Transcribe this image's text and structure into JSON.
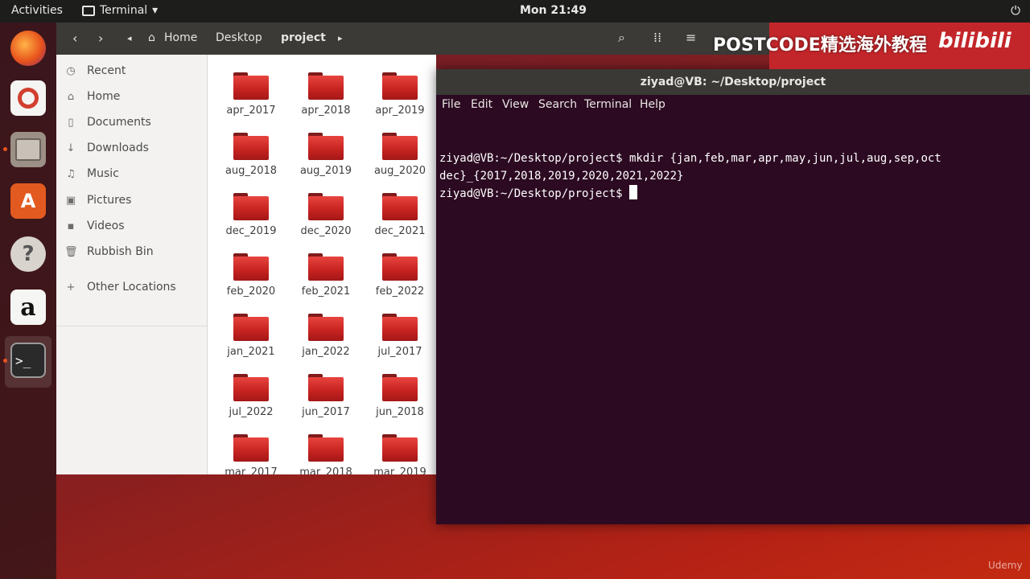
{
  "topbar": {
    "activities": "Activities",
    "app_name": "Terminal",
    "clock": "Mon 21:49",
    "power_icon": "power-icon"
  },
  "dock": {
    "items": [
      {
        "name": "firefox",
        "icon": "firefox-icon"
      },
      {
        "name": "rhythmbox",
        "icon": "rhythmbox-icon"
      },
      {
        "name": "files",
        "icon": "files-icon"
      },
      {
        "name": "ubuntu-software",
        "icon": "software-icon",
        "glyph": "A"
      },
      {
        "name": "help",
        "icon": "help-icon",
        "glyph": "?"
      },
      {
        "name": "amazon",
        "icon": "amazon-icon",
        "glyph": "a"
      },
      {
        "name": "terminal",
        "icon": "terminal-icon",
        "glyph": ">_"
      }
    ]
  },
  "file_manager": {
    "breadcrumb": [
      "Home",
      "Desktop",
      "project"
    ],
    "sidebar": [
      {
        "label": "Recent",
        "glyph": "◷"
      },
      {
        "label": "Home",
        "glyph": "⌂"
      },
      {
        "label": "Documents",
        "glyph": "▯"
      },
      {
        "label": "Downloads",
        "glyph": "↓"
      },
      {
        "label": "Music",
        "glyph": "♫"
      },
      {
        "label": "Pictures",
        "glyph": "▣"
      },
      {
        "label": "Videos",
        "glyph": "▪"
      },
      {
        "label": "Rubbish Bin",
        "glyph": "🗑"
      },
      {
        "label": "Other Locations",
        "glyph": "+"
      }
    ],
    "folders": [
      "apr_2017",
      "apr_2018",
      "apr_2019",
      "aug_2018",
      "aug_2019",
      "aug_2020",
      "dec_2019",
      "dec_2020",
      "dec_2021",
      "feb_2020",
      "feb_2021",
      "feb_2022",
      "jan_2021",
      "jan_2022",
      "jul_2017",
      "jul_2022",
      "jun_2017",
      "jun_2018",
      "mar_2017",
      "mar_2018",
      "mar_2019"
    ]
  },
  "terminal": {
    "title": "ziyad@VB: ~/Desktop/project",
    "menu": [
      "File",
      "Edit",
      "View",
      "Search",
      "Terminal",
      "Help"
    ],
    "lines": [
      "ziyad@VB:~/Desktop/project$ mkdir {jan,feb,mar,apr,may,jun,jul,aug,sep,oct",
      "dec}_{2017,2018,2019,2020,2021,2022}",
      "ziyad@VB:~/Desktop/project$ "
    ]
  },
  "watermark": {
    "text": "POSTCODE精选海外教程",
    "brand": "bilibili"
  },
  "udemy": "Udemy"
}
